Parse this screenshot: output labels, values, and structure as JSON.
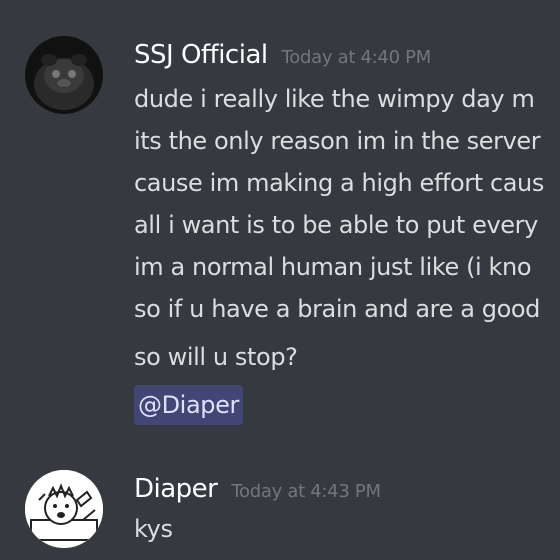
{
  "messages": [
    {
      "author": "SSJ Official",
      "timestamp": "Today at 4:40 PM",
      "avatar_icon": "dark-character-avatar-icon",
      "lines": [
        "dude i really like the wimpy day m",
        "its the only reason im in the server",
        "cause im making a high effort caus",
        "all i want is to be able to put every",
        "im a normal human just like (i kno",
        "so if u have a brain and are a good",
        "so will u stop?"
      ],
      "mention": "@Diaper"
    },
    {
      "author": "Diaper",
      "timestamp": "Today at 4:43 PM",
      "avatar_icon": "sketch-character-avatar-icon",
      "lines": [
        "kys"
      ]
    }
  ],
  "colors": {
    "background": "#36393f",
    "username": "#ffffff",
    "timestamp": "#72767d",
    "message_text": "#dcddde",
    "mention_bg": "#414675",
    "mention_text": "#dee0fc"
  }
}
